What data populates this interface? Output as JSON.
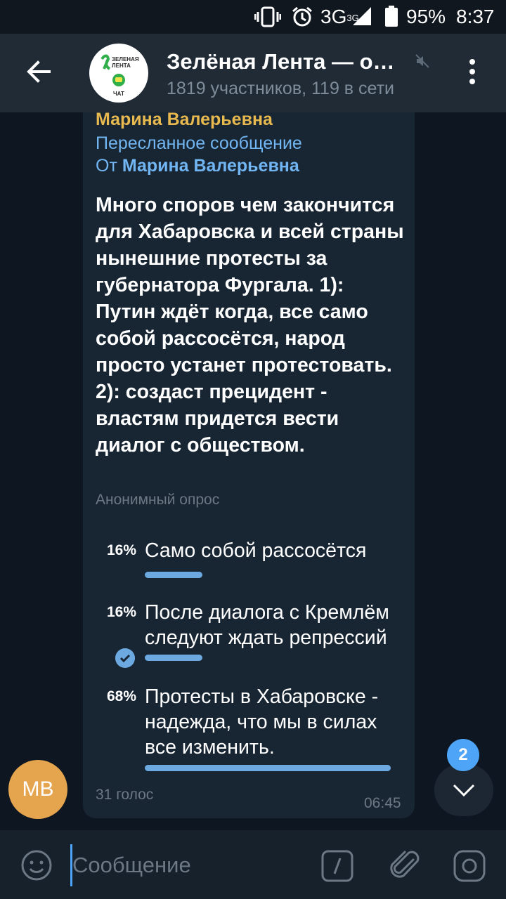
{
  "status_bar": {
    "network": "3G",
    "network_sup": "3G",
    "battery": "95%",
    "time": "8:37"
  },
  "header": {
    "title": "Зелёная Лента — о…",
    "subtitle": "1819 участников, 119 в сети",
    "avatar_lines": [
      "ЗЕЛЕНАЯ",
      "ЛЕНТА",
      "ЧАТ"
    ]
  },
  "message": {
    "sender": "Марина Валерьевна",
    "forwarded_label": "Пересланное сообщение",
    "forwarded_from_prefix": "От",
    "forwarded_from_name": "Марина Валерьевна",
    "question": "Много споров чем закончится для Хабаровска и всей страны нынешние протесты за губернатора Фургала. 1): Путин ждёт когда, все само собой рассосётся, народ просто устанет протестовать. 2): создаст прецидент - властям придется вести диалог с обществом.",
    "poll_type": "Анонимный опрос",
    "options": [
      {
        "percent": "16%",
        "text": "Само собой рассосётся",
        "fraction": 0.16,
        "chosen": false
      },
      {
        "percent": "16%",
        "text": "После диалога с Кремлём следуют ждать репрессий",
        "fraction": 0.16,
        "chosen": true
      },
      {
        "percent": "68%",
        "text": "Протесты в Хабаровске  - надежда, что мы в силах все изменить.",
        "fraction": 0.68,
        "chosen": false
      }
    ],
    "votes": "31 голос",
    "time": "06:45"
  },
  "sender_avatar": "MB",
  "unread_badge": "2",
  "composer": {
    "placeholder": "Сообщение"
  },
  "colors": {
    "background": "#0e1621",
    "header": "#202b36",
    "bubble": "#182533",
    "accent": "#6ba9e0",
    "sender_name": "#e8b94e",
    "badge": "#4ea4f6"
  }
}
